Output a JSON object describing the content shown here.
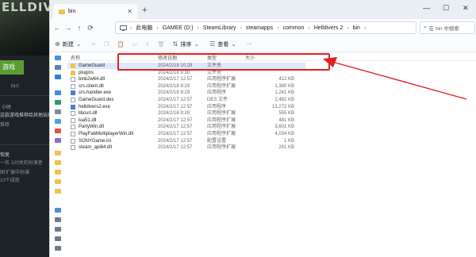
{
  "background_app": {
    "hero_text": "ELLDIVERS",
    "play_label": "游戏",
    "dlc_label": "DLC",
    "lines": [
      {
        "text": "小时",
        "accent": true
      },
      {
        "text": "这款游戏推荐给其他玩家吗?"
      },
      {
        "text": "推荐"
      },
      {
        "text": "恢复"
      },
      {
        "text": "一名 100关的扮演者"
      },
      {
        "text": "国'扩展中扮演"
      },
      {
        "text": "10个成就"
      }
    ]
  },
  "explorer": {
    "tab_title": "bin",
    "new_tab": "+",
    "window_controls": {
      "minimize": "—",
      "maximize": "☐",
      "close": "✕"
    },
    "breadcrumbs": [
      "此电脑",
      "GAMEE (D:)",
      "SteamLibrary",
      "steamapps",
      "common",
      "Helldivers 2",
      "bin"
    ],
    "search_placeholder": "在 bin 中搜索",
    "toolbar": {
      "new_label": "新建",
      "sort_label": "排序",
      "view_label": "查看",
      "more": "···"
    },
    "columns": {
      "name": "名称",
      "modified": "修改日期",
      "type": "类型",
      "size": "大小"
    },
    "files": [
      {
        "name": "GameGuard",
        "modified": "2024/2/18 10:28",
        "type": "文件夹",
        "size": "",
        "kind": "folder",
        "selected": true
      },
      {
        "name": "plugins",
        "modified": "2024/2/18 9:30",
        "type": "文件夹",
        "size": "",
        "kind": "folder"
      },
      {
        "name": "bink2w64.dll",
        "modified": "2024/2/17 12:57",
        "type": "应用程序扩展",
        "size": "412 KB",
        "kind": "doc"
      },
      {
        "name": "crs-client.dll",
        "modified": "2024/2/18 9:29",
        "type": "应用程序扩展",
        "size": "1,380 KB",
        "kind": "doc"
      },
      {
        "name": "crs-handler.exe",
        "modified": "2024/2/18 9:29",
        "type": "应用程序",
        "size": "1,241 KB",
        "kind": "exe"
      },
      {
        "name": "GameGuard.des",
        "modified": "2024/2/17 12:57",
        "type": "DES 文件",
        "size": "2,482 KB",
        "kind": "doc"
      },
      {
        "name": "helldivers2.exe",
        "modified": "2024/2/17 12:57",
        "type": "应用程序",
        "size": "13,272 KB",
        "kind": "exe"
      },
      {
        "name": "libcurl.dll",
        "modified": "2024/2/18 9:29",
        "type": "应用程序扩展",
        "size": "555 KB",
        "kind": "doc"
      },
      {
        "name": "lua51.dll",
        "modified": "2024/2/17 12:57",
        "type": "应用程序扩展",
        "size": "481 KB",
        "kind": "doc"
      },
      {
        "name": "PartyWin.dll",
        "modified": "2024/2/17 12:57",
        "type": "应用程序扩展",
        "size": "3,601 KB",
        "kind": "doc"
      },
      {
        "name": "PlayFabMultiplayerWin.dll",
        "modified": "2024/2/17 12:57",
        "type": "应用程序扩展",
        "size": "4,034 KB",
        "kind": "doc"
      },
      {
        "name": "SONYGame.ini",
        "modified": "2024/2/17 12:57",
        "type": "配置设置",
        "size": "1 KB",
        "kind": "doc"
      },
      {
        "name": "steam_api64.dll",
        "modified": "2024/2/17 12:57",
        "type": "应用程序扩展",
        "size": "291 KB",
        "kind": "doc"
      }
    ],
    "highlight_color": "#e02020"
  }
}
